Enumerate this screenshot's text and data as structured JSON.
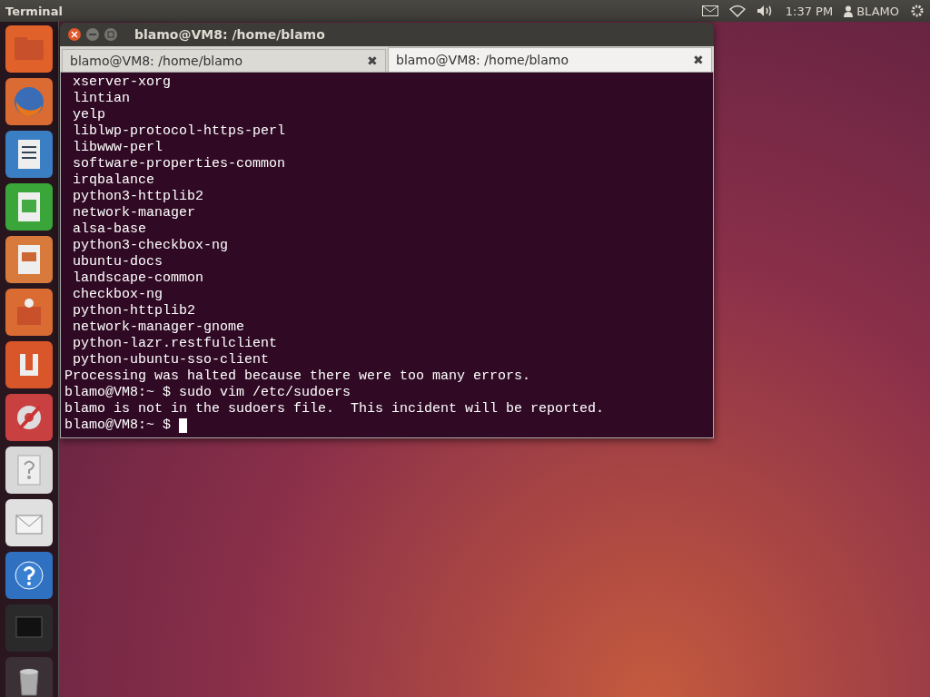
{
  "top_bar": {
    "app_title": "Terminal",
    "clock": "1:37 PM",
    "user": "BLAMO"
  },
  "window": {
    "title": "blamo@VM8: /home/blamo",
    "tabs": [
      {
        "label": "blamo@VM8: /home/blamo",
        "selected": false,
        "close": "✖"
      },
      {
        "label": "blamo@VM8: /home/blamo",
        "selected": true,
        "close": "✖"
      }
    ],
    "terminal_lines": [
      " xserver-xorg",
      " lintian",
      " yelp",
      " liblwp-protocol-https-perl",
      " libwww-perl",
      " software-properties-common",
      " irqbalance",
      " python3-httplib2",
      " network-manager",
      " alsa-base",
      " python3-checkbox-ng",
      " ubuntu-docs",
      " landscape-common",
      " checkbox-ng",
      " python-httplib2",
      " network-manager-gnome",
      " python-lazr.restfulclient",
      " python-ubuntu-sso-client",
      "Processing was halted because there were too many errors.",
      "blamo@VM8:~ $ sudo vim /etc/sudoers",
      "blamo is not in the sudoers file.  This incident will be reported."
    ],
    "prompt": "blamo@VM8:~ $ "
  }
}
